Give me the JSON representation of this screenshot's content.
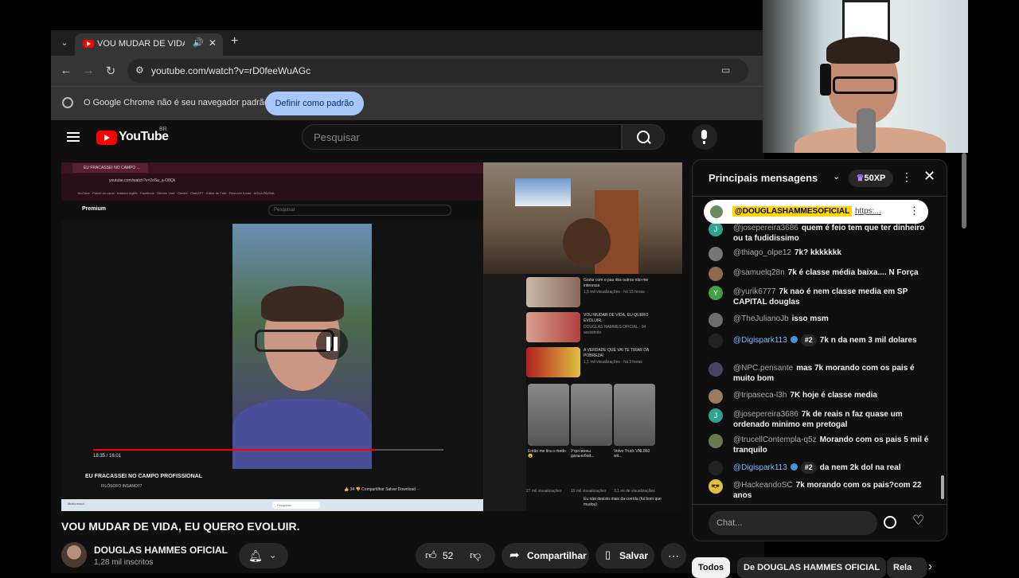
{
  "browser": {
    "tab_title": "VOU MUDAR DE VIDA, EU",
    "url": "youtube.com/watch?v=rD0feeWuAGc",
    "infobar_text": "O Google Chrome não é seu navegador padrão",
    "infobar_button": "Definir como padrão"
  },
  "youtube": {
    "logo_text": "YouTube",
    "country_code": "BR",
    "search_placeholder": "Pesquisar"
  },
  "video": {
    "title": "VOU MUDAR DE VIDA, EU QUERO EVOLUIR.",
    "channel_name": "DOUGLAS HAMMES OFICIAL",
    "subscribers": "1,28 mil inscritos",
    "likes": "52",
    "share_label": "Compartilhar",
    "save_label": "Salvar"
  },
  "inner_screen": {
    "tab_title": "EU FRACASSEI NO CAMPO ...",
    "url": "youtube.com/watch?v=2oSu_a-O8Qk",
    "bookmarks": "YouTube · Painel do canal · tradutor inglês · Facebook · Stream Yard · Gemini · ChatGPT · Editor de Foto · Remover fundo · AGUA PAGNA",
    "logo": "Premium",
    "search_placeholder": "Pesquisar",
    "time": "18:35 / 16:01",
    "title": "EU FRACASSEI NO CAMPO PROFISSIONAL",
    "channel": "FILÓSOFO INSANO77",
    "actions": "👍 34  👎  Compartilhar  Salvar  Download  ⋯",
    "taskbar_weather": "Muito ensol.",
    "taskbar_search": "Pesquisar",
    "sidebar": [
      {
        "title": "Gozar com o pau dos outros não me interessa",
        "meta": "1,5 mil visualizações · há 15 horas"
      },
      {
        "title": "VOU MUDAR DE VIDA, EU QUERO EVOLUIR.",
        "meta": "DOUGLAS HAMMES OFICIAL · 94 assistindo"
      },
      {
        "title": "A VERDADE QUE VAI TE TIRAR DA POBREZA!",
        "meta": "1,1 mil visualizações · há 3 horas"
      },
      {
        "title": "Eu não desisto mais da corrida (fui bom que mudou)",
        "meta": ""
      }
    ],
    "shorts": [
      {
        "caption": "Então me tira o medo 😮",
        "views": "27 mil visualizações"
      },
      {
        "caption": "Утро жены дальнобой...",
        "views": "19 mil visualizações"
      },
      {
        "caption": "Volvo Truck VNL860 wit...",
        "views": "3,1 mi de visualizações"
      }
    ]
  },
  "chat": {
    "header": "Principais mensagens",
    "xp_badge": "50XP",
    "pinned": {
      "author": "@DOUGLASHAMMESOFICIAL",
      "text": "https:..."
    },
    "messages": [
      {
        "author": "@josepereira3686",
        "text": "quem é feio tem que ter dinheiro ou ta fudidissimo",
        "avatar_color": "#2ea38f",
        "initial": "J"
      },
      {
        "author": "@thiago_olpe12",
        "text": "7k? kkkkkkk",
        "avatar_color": "#777777",
        "initial": ""
      },
      {
        "author": "@samuelq28n",
        "text": "7k é classe média baixa.... N Força",
        "avatar_color": "#8a6a50",
        "initial": ""
      },
      {
        "author": "@yurik6777",
        "text": "7k nao é nem classe media em SP CAPITAL douglas",
        "avatar_color": "#43a047",
        "initial": "Y"
      },
      {
        "author": "@TheJulianoJb",
        "text": "isso msm",
        "avatar_color": "#6d6d6d",
        "initial": ""
      },
      {
        "author": "@Digispark113",
        "text": "7k n da nem 3 mil dolares",
        "avatar_color": "#222222",
        "initial": "",
        "verified": true,
        "rank": "#2"
      },
      {
        "author": "@NPC.pensante",
        "text": "mas 7k morando com os pais é muito bom",
        "avatar_color": "#444466",
        "initial": ""
      },
      {
        "author": "@tripaseca-l3h",
        "text": "7K hoje é classe media",
        "avatar_color": "#9a7a60",
        "initial": ""
      },
      {
        "author": "@josepereira3686",
        "text": "7k de reais n faz quase um ordenado minimo em pretogal",
        "avatar_color": "#2ea38f",
        "initial": "J"
      },
      {
        "author": "@trucellContempla-q5z",
        "text": "Morando com os pais 5 mil é tranquilo",
        "avatar_color": "#6a7a4a",
        "initial": ""
      },
      {
        "author": "@Digispark113",
        "text": "da nem 2k dol na real",
        "avatar_color": "#222222",
        "initial": "",
        "verified": true,
        "rank": "#2"
      },
      {
        "author": "@HackeandoSC",
        "text": "7k morando com os pais?com 22 anos",
        "avatar_color": "#e0c040",
        "initial": "😎"
      }
    ],
    "input_placeholder": "Chat..."
  },
  "chips": [
    "Todos",
    "De DOUGLAS HAMMES OFICIAL",
    "Rela"
  ]
}
